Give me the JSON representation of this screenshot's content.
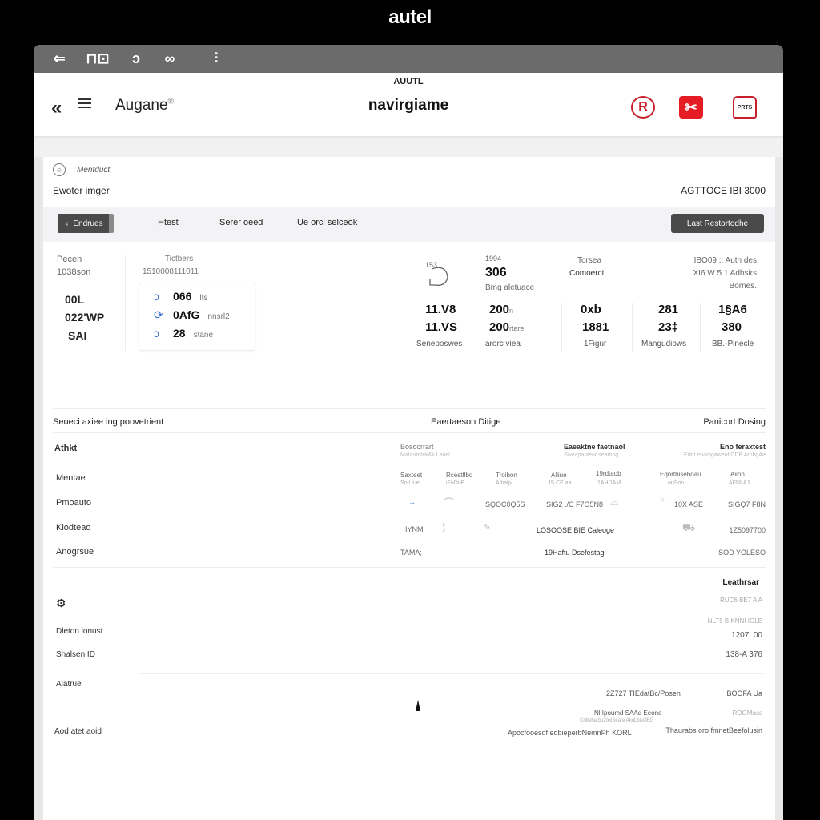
{
  "brand": "autel",
  "titlebar": {
    "icons": [
      "back-arrow-icon",
      "window-icon",
      "link-icon",
      "infinity-icon",
      "signal-icon"
    ],
    "glyphs": [
      "⇐",
      "⊓⊡",
      "ↄ",
      "∞",
      "⫶"
    ]
  },
  "appbar": {
    "small_title": "AUUTL",
    "back_glyph": "«",
    "app_name": "Augane",
    "app_name_mark": "®",
    "center_title": "navirgiame",
    "actions": [
      {
        "name": "record-icon",
        "glyph": "R"
      },
      {
        "name": "tools-icon",
        "glyph": "✂"
      },
      {
        "name": "report-icon",
        "glyph": "PRTS"
      }
    ]
  },
  "content": {
    "breadcrumb": {
      "icon_glyph": "☺",
      "label": "Mentduct"
    },
    "section_title": "Ewoter imger",
    "model_id": "AGTTOCE IBI 3000",
    "tabs": {
      "back_label": "Endrues",
      "items": [
        "Htest",
        "Serer oeed",
        "Ue orcl selceok"
      ],
      "cta_label": "Last Restortodhe"
    },
    "stats_left": {
      "label_1": "Pecen",
      "label_2": "1038son",
      "values": [
        "00L",
        "022'WP",
        "SAI"
      ],
      "card_title": "Tictbers",
      "card_sub": "1510008111011",
      "rows": [
        {
          "icon": "pulse-icon",
          "glyph": "ↄ",
          "value": "066",
          "unit": "lts"
        },
        {
          "icon": "refresh-icon",
          "glyph": "⟳",
          "value": "0AfG",
          "unit": "nnsrl2"
        },
        {
          "icon": "cycle-icon",
          "glyph": "ↄ",
          "value": "28",
          "unit": "stane"
        }
      ]
    },
    "stats_right": {
      "gauge_label": "153",
      "top_small": "1994",
      "top_value": "306",
      "top_caption": "Bmg aletuace",
      "torsea_label": "Torsea",
      "torsea_value": "Comoerct",
      "note_lines": [
        "IBO09 :: Auth des",
        "XI6 W 5 1 Adhsirs",
        "Bornes."
      ],
      "columns": [
        {
          "top": "11.V8",
          "bottom": "11.VS",
          "caption": "Seneposwes"
        },
        {
          "top": "200",
          "top_unit": "n",
          "bottom": "200",
          "bottom_unit": "rtare",
          "caption": "arorc viea"
        },
        {
          "top": "0xb",
          "bottom": "1881",
          "caption": "1Figur"
        },
        {
          "top": "281",
          "bottom": "23‡",
          "caption": "Mangudiows"
        },
        {
          "top": "1§A6",
          "bottom": "380",
          "caption": "BB.-Pinecle"
        }
      ]
    },
    "list_section": {
      "title": "Seueci axiee ing poovetrient",
      "items": [
        "Athkt",
        "Mentae",
        "Pmoauto",
        "Klodteao",
        "Anogrsue"
      ]
    },
    "right_table": {
      "title_left": "Eaertaeson Ditige",
      "title_right": "Panicort Dosing",
      "groups": [
        {
          "title": "Bosocrrart",
          "sub": "Mataumtek&k Lauel",
          "bold": false
        },
        {
          "title": "Eaeaktne faetnaol",
          "sub": "Sweapa.aeur searting",
          "bold": true
        },
        {
          "title": "Eno feraxtest",
          "sub": "Ednt enamgaweof CDB ArnbgAe",
          "bold": true
        }
      ],
      "columns": [
        {
          "head": "Saxteet",
          "sub": "Sotl tue"
        },
        {
          "head": "Rcestflbo",
          "sub": "iFoDoE"
        },
        {
          "head": "Troibon",
          "sub": "Adiatjv"
        },
        {
          "head": "Aliiue",
          "sub": "JS CE aa"
        },
        {
          "head": "19rdtaob",
          "sub": "1AHDAM"
        },
        {
          "head": "Eqnrtbiseboau",
          "sub": "ouSon"
        },
        {
          "head": "Aiion",
          "sub": "AFNLAJ"
        }
      ],
      "row_1": [
        "→",
        "SQOC0Q5S",
        "SIG2 ./C F7O5N8",
        "10X ASE",
        "SIGQ7 F8N"
      ],
      "row_2": [
        "IYNM",
        "LOSOOSE BIE Caleoge",
        "1Z5097700"
      ],
      "row_3": [
        "TAMA;",
        "19Haftu Dsefestag",
        "SOD YOLESO"
      ]
    },
    "bottom": {
      "icon_glyph": "⚙",
      "labels": [
        "Dleton lonust",
        "Shalsen ID",
        "Alatrue",
        "Aod atet aoid"
      ],
      "right_header": "Leathrsar",
      "right_sub_1": "RUC6 BE7 A A",
      "right_sub_2": "NLT5 B KNNI IOLE",
      "value_1": "1207. 00",
      "value_2": "138-A 376",
      "row_mid": "2Z727 TIEdatBc/Posen",
      "row_mid_right": "BOOFA Ua",
      "row_sub": "Nl.Ipoumd SAAd Eeone",
      "row_sub_2": "Cnbeha bu2oxiSeare AkuLbisOEG",
      "row_sub_right": "ROGMass",
      "row_last_left": "Apocfooesdf edbieperbNemnPh KORL",
      "row_last_right": "Thaurabs oro fmnetBeefolusin"
    }
  }
}
